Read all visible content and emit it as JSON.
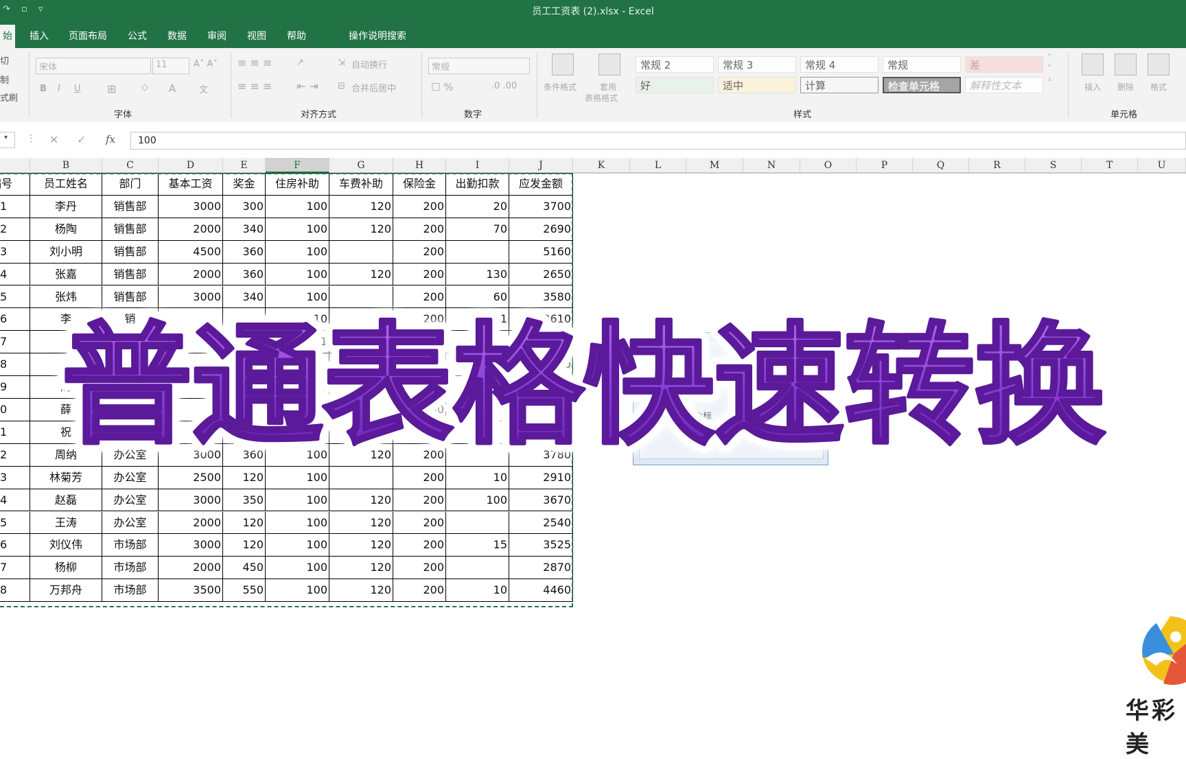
{
  "window": {
    "title": "员工工资表 (2).xlsx  -  Excel",
    "accent": "#217346"
  },
  "ribbon_tabs": [
    "始",
    "插入",
    "页面布局",
    "公式",
    "数据",
    "审阅",
    "视图",
    "帮助"
  ],
  "tell_me": "操作说明搜索",
  "clipboard": {
    "cut": "切",
    "copy": "制",
    "format_painter": "式刷"
  },
  "font": {
    "name": "宋体",
    "size": "11",
    "group_label": "字体"
  },
  "alignment": {
    "wrap": "自动换行",
    "merge": "合并后居中",
    "group_label": "对齐方式"
  },
  "number": {
    "format": "常规",
    "group_label": "数字"
  },
  "styles": {
    "conditional": "条件格式",
    "table_format_1": "套用",
    "table_format_2": "表格格式",
    "group_label": "样式",
    "gallery": [
      "常规 2",
      "常规 3",
      "常规 4",
      "常规",
      "差",
      "好",
      "适中",
      "计算",
      "检查单元格",
      "解释性文本"
    ]
  },
  "cells": {
    "insert": "插入",
    "delete": "删除",
    "format": "格式",
    "group_label": "单元格"
  },
  "formula_bar": {
    "value": "100",
    "fx": "fx"
  },
  "columns": [
    "B",
    "C",
    "D",
    "E",
    "F",
    "G",
    "H",
    "I",
    "J",
    "K",
    "L",
    "M",
    "N",
    "O",
    "P",
    "Q",
    "R",
    "S",
    "T",
    "U"
  ],
  "table": {
    "headers": [
      "编号",
      "员工姓名",
      "部门",
      "基本工资",
      "奖金",
      "住房补助",
      "车费补助",
      "保险金",
      "出勤扣款",
      "应发金额"
    ],
    "rows": [
      [
        "1",
        "李丹",
        "销售部",
        "3000",
        "300",
        "100",
        "120",
        "200",
        "20",
        "3700"
      ],
      [
        "2",
        "杨陶",
        "销售部",
        "2000",
        "340",
        "100",
        "120",
        "200",
        "70",
        "2690"
      ],
      [
        "3",
        "刘小明",
        "销售部",
        "4500",
        "360",
        "100",
        "",
        "200",
        "",
        "5160"
      ],
      [
        "4",
        "张嘉",
        "销售部",
        "2000",
        "360",
        "100",
        "120",
        "200",
        "130",
        "2650"
      ],
      [
        "5",
        "张炜",
        "销售部",
        "3000",
        "340",
        "100",
        "",
        "200",
        "60",
        "3580"
      ],
      [
        "6",
        "李",
        "销",
        "",
        "",
        "10",
        "",
        "200",
        "11",
        "3610"
      ],
      [
        "7",
        "",
        "",
        "",
        "",
        "1",
        "",
        "",
        "",
        "0"
      ],
      [
        "8",
        "",
        "",
        "",
        "",
        "",
        "",
        "",
        "",
        "00"
      ],
      [
        "9",
        "周",
        "",
        "",
        "",
        "1",
        "",
        "",
        "",
        "0"
      ],
      [
        "0",
        "薛",
        "",
        "",
        "",
        "",
        "",
        "200",
        "",
        "0"
      ],
      [
        "1",
        "祝",
        "",
        "",
        "",
        "00",
        "",
        "",
        "",
        "0"
      ],
      [
        "2",
        "周纳",
        "办公室",
        "3000",
        "360",
        "100",
        "120",
        "200",
        "",
        "3780"
      ],
      [
        "3",
        "林菊芳",
        "办公室",
        "2500",
        "120",
        "100",
        "",
        "200",
        "10",
        "2910"
      ],
      [
        "4",
        "赵磊",
        "办公室",
        "3000",
        "350",
        "100",
        "120",
        "200",
        "100",
        "3670"
      ],
      [
        "5",
        "王涛",
        "办公室",
        "2000",
        "120",
        "100",
        "120",
        "200",
        "",
        "2540"
      ],
      [
        "6",
        "刘仪伟",
        "市场部",
        "3000",
        "120",
        "100",
        "120",
        "200",
        "15",
        "3525"
      ],
      [
        "7",
        "杨柳",
        "市场部",
        "2000",
        "450",
        "100",
        "120",
        "200",
        "",
        "2870"
      ],
      [
        "8",
        "万邦舟",
        "市场部",
        "3500",
        "550",
        "100",
        "120",
        "200",
        "10",
        "4460"
      ]
    ]
  },
  "dialog_fragment": "包含标",
  "caption": "普通表格快速转换",
  "logo_text": "华彩美"
}
